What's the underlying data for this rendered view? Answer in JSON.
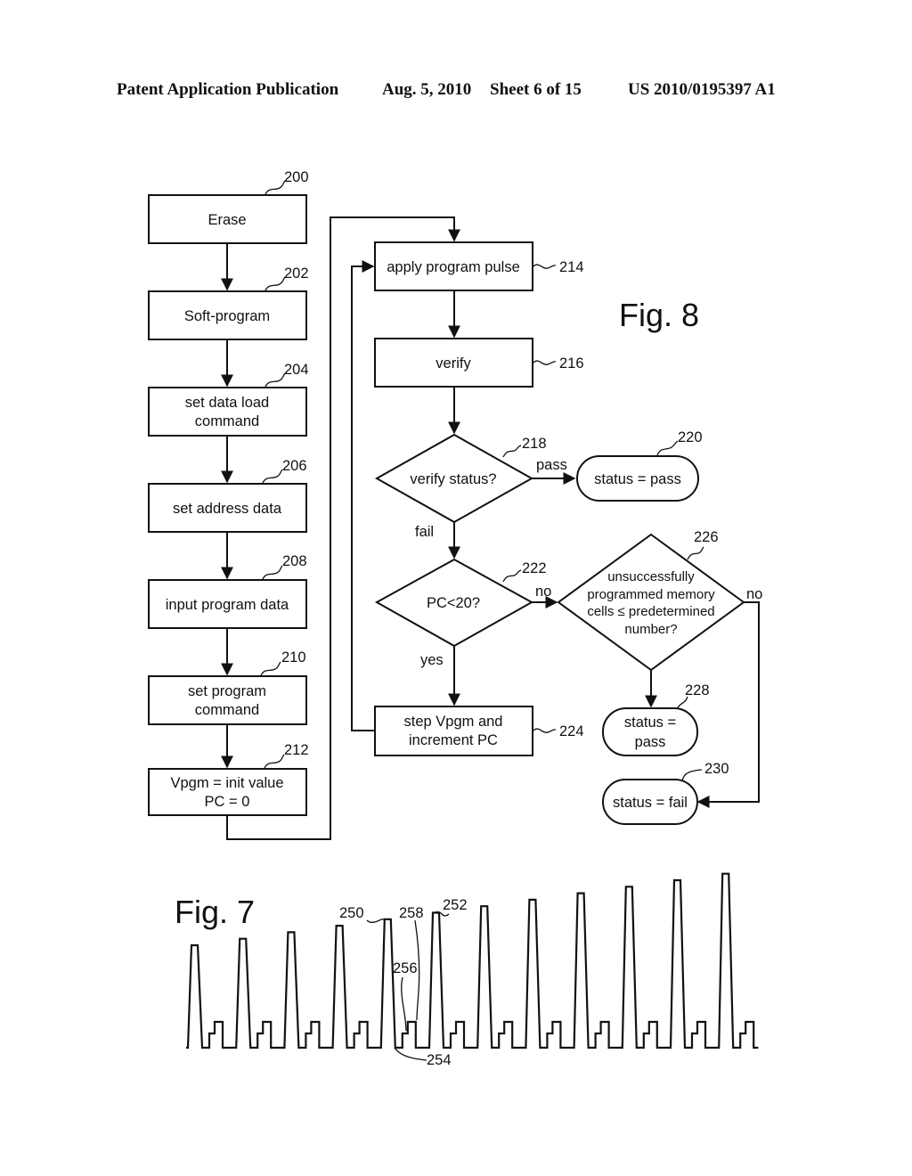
{
  "header": {
    "publication": "Patent Application Publication",
    "date": "Aug. 5, 2010",
    "sheet": "Sheet 6 of 15",
    "number": "US 2010/0195397 A1"
  },
  "fig8": {
    "title": "Fig. 8",
    "steps": {
      "s200": {
        "ref": "200",
        "lines": [
          "Erase"
        ]
      },
      "s202": {
        "ref": "202",
        "lines": [
          "Soft-program"
        ]
      },
      "s204": {
        "ref": "204",
        "lines": [
          "set data load",
          "command"
        ]
      },
      "s206": {
        "ref": "206",
        "lines": [
          "set address data"
        ]
      },
      "s208": {
        "ref": "208",
        "lines": [
          "input program data"
        ]
      },
      "s210": {
        "ref": "210",
        "lines": [
          "set program",
          "command"
        ]
      },
      "s212": {
        "ref": "212",
        "lines": [
          "Vpgm = init value",
          "PC = 0"
        ]
      },
      "s214": {
        "ref": "214",
        "lines": [
          "apply program pulse"
        ]
      },
      "s216": {
        "ref": "216",
        "lines": [
          "verify"
        ]
      },
      "s218": {
        "ref": "218",
        "lines": [
          "verify status?"
        ]
      },
      "s220": {
        "ref": "220",
        "lines": [
          "status = pass"
        ]
      },
      "s222": {
        "ref": "222",
        "lines": [
          "PC<20?"
        ]
      },
      "s224": {
        "ref": "224",
        "lines": [
          "step Vpgm and",
          "increment PC"
        ]
      },
      "s226": {
        "ref": "226",
        "lines": [
          "unsuccessfully",
          "programmed memory",
          "cells ≤ predetermined",
          "number?"
        ]
      },
      "s228": {
        "ref": "228",
        "lines": [
          "status =",
          "pass"
        ]
      },
      "s230": {
        "ref": "230",
        "lines": [
          "status = fail"
        ]
      }
    },
    "edge_labels": {
      "pass": "pass",
      "fail": "fail",
      "no_222": "no",
      "yes_222": "yes",
      "no_226": "no"
    }
  },
  "fig7": {
    "title": "Fig. 7",
    "refs": {
      "r250": "250",
      "r252": "252",
      "r254": "254",
      "r256": "256",
      "r258": "258"
    },
    "pulse_count": 12,
    "pulse_step_relative": [
      0,
      1,
      2,
      3,
      4,
      5,
      6,
      7,
      8,
      9,
      10,
      11
    ],
    "verify_levels_per_cycle": 2
  }
}
